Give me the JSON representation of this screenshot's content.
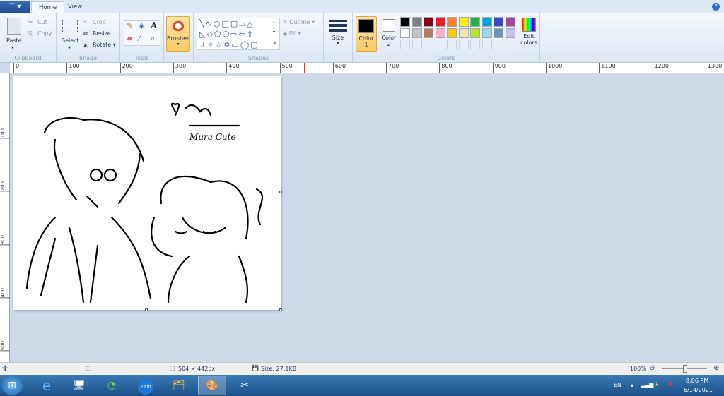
{
  "tabs": [
    {
      "label": "Home",
      "active": true
    },
    {
      "label": "View",
      "active": false
    }
  ],
  "ribbon": {
    "clipboard": {
      "label": "Clipboard",
      "paste": "Paste",
      "cut": "Cut",
      "copy": "Copy"
    },
    "image": {
      "label": "Image",
      "select": "Select",
      "crop": "Crop",
      "resize": "Resize",
      "rotate": "Rotate"
    },
    "tools": {
      "label": "Tools",
      "items": [
        "pencil",
        "fill",
        "text",
        "eraser",
        "color-picker",
        "magnifier"
      ]
    },
    "brushes": {
      "label": "Brushes"
    },
    "shapes": {
      "label": "Shapes",
      "outline": "Outline",
      "fill": "Fill"
    },
    "size": {
      "label": "Size"
    },
    "colors": {
      "label": "Colors",
      "color1": "Color",
      "color1_num": "1",
      "color2": "Color",
      "color2_num": "2",
      "edit": "Edit",
      "edit2": "colors",
      "color1_value": "#000000",
      "color2_value": "#ffffff",
      "palette_row1": [
        "#000000",
        "#7f7f7f",
        "#880015",
        "#ed1c24",
        "#ff7f27",
        "#fff200",
        "#22b14c",
        "#00a2e8",
        "#3f48cc",
        "#a349a4"
      ],
      "palette_row2": [
        "#ffffff",
        "#c3c3c3",
        "#b97a57",
        "#ffaec9",
        "#ffc90e",
        "#efe4b0",
        "#b5e61d",
        "#99d9ea",
        "#7092be",
        "#c8bfe7"
      ]
    }
  },
  "ruler": {
    "h": [
      "0",
      "100",
      "200",
      "300",
      "400",
      "500",
      "600",
      "700",
      "800",
      "900",
      "1000",
      "1100",
      "1200",
      "1300"
    ],
    "v": [
      "100",
      "200",
      "300",
      "400",
      "500"
    ]
  },
  "canvas": {
    "signature": "Mura Cute"
  },
  "status": {
    "dimensions": "504 × 442px",
    "size": "Size: 27.1KB",
    "zoom": "100%",
    "zoom_level": 100
  },
  "taskbar": {
    "lang": "EN",
    "time": "8:06 PM",
    "date": "6/14/2021",
    "apps": [
      "start",
      "internet-explorer",
      "computer",
      "coccoc",
      "zalo",
      "file-explorer",
      "paint",
      "snipping-tool"
    ]
  }
}
